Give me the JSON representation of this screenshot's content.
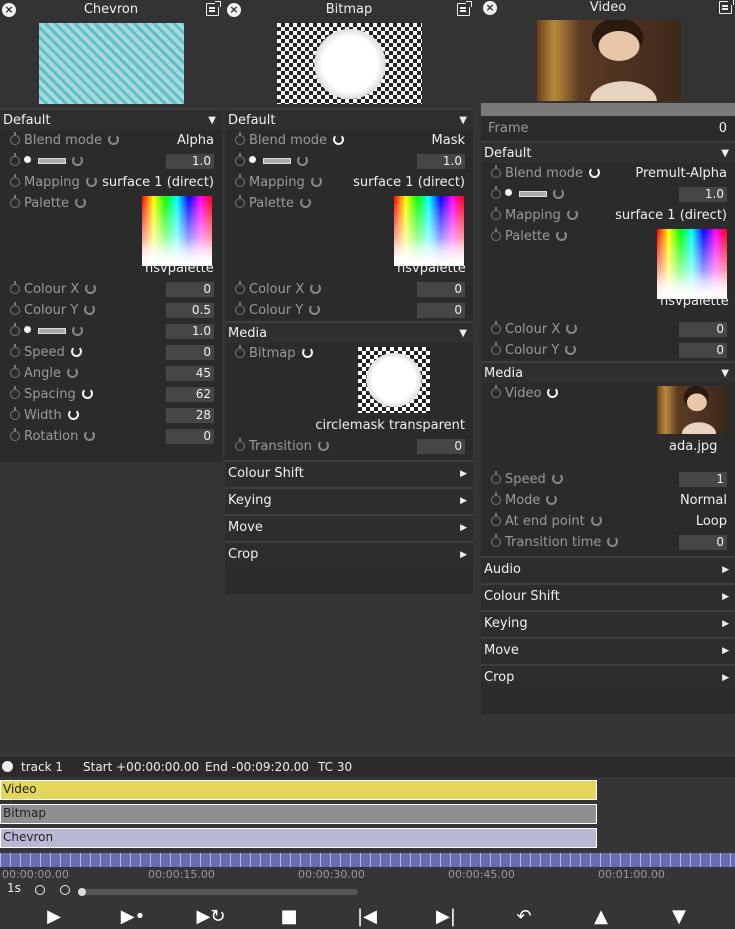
{
  "chevron": {
    "title": "Chevron",
    "section": "Default",
    "blend_label": "Blend mode",
    "blend_value": "Alpha",
    "opacity_value": "1.0",
    "mapping_label": "Mapping",
    "mapping_value": "surface 1 (direct)",
    "palette_label": "Palette",
    "palette_name": "hsvpalette",
    "params": [
      {
        "label": "Colour X",
        "value": "0"
      },
      {
        "label": "Colour Y",
        "value": "0.5"
      },
      {
        "label": "",
        "value": "1.0"
      },
      {
        "label": "Speed",
        "value": "0"
      },
      {
        "label": "Angle",
        "value": "45"
      },
      {
        "label": "Spacing",
        "value": "62"
      },
      {
        "label": "Width",
        "value": "28"
      },
      {
        "label": "Rotation",
        "value": "0"
      }
    ]
  },
  "bitmap": {
    "title": "Bitmap",
    "section": "Default",
    "blend_label": "Blend mode",
    "blend_value": "Mask",
    "opacity_value": "1.0",
    "mapping_label": "Mapping",
    "mapping_value": "surface 1 (direct)",
    "palette_label": "Palette",
    "palette_name": "hsvpalette",
    "colour_x_label": "Colour X",
    "colour_x": "0",
    "colour_y_label": "Colour Y",
    "colour_y": "0",
    "media_section": "Media",
    "bitmap_label": "Bitmap",
    "bitmap_name": "circlemask transparent",
    "transition_label": "Transition",
    "transition_value": "0",
    "collapsed": [
      "Colour Shift",
      "Keying",
      "Move",
      "Crop"
    ]
  },
  "video": {
    "title": "Video",
    "frame_label": "Frame",
    "frame_value": "0",
    "section": "Default",
    "blend_label": "Blend mode",
    "blend_value": "Premult-Alpha",
    "opacity_value": "1.0",
    "mapping_label": "Mapping",
    "mapping_value": "surface 1 (direct)",
    "palette_label": "Palette",
    "palette_name": "hsvpalette",
    "colour_x_label": "Colour X",
    "colour_x": "0",
    "colour_y_label": "Colour Y",
    "colour_y": "0",
    "media_section": "Media",
    "video_label": "Video",
    "video_name": "ada.jpg",
    "speed_label": "Speed",
    "speed_value": "1",
    "mode_label": "Mode",
    "mode_value": "Normal",
    "endpoint_label": "At end point",
    "endpoint_value": "Loop",
    "transition_label": "Transition time",
    "transition_value": "0",
    "collapsed": [
      "Audio",
      "Colour Shift",
      "Keying",
      "Move",
      "Crop"
    ]
  },
  "timeline": {
    "track": "track 1",
    "start": "Start +00:00:00.00",
    "end": "End -00:09:20.00",
    "tc": "TC 30",
    "tracks": [
      "Video",
      "Bitmap",
      "Chevron"
    ],
    "track_colors": [
      "#e4d65a",
      "#8f8f8f",
      "#b9b9d6"
    ],
    "ruler_labels": [
      "00:00:00.00",
      "00:00:15.00",
      "00:00:30.00",
      "00:00:45.00",
      "00:01:00.00"
    ],
    "scale": "1s"
  },
  "icons": [
    "close-icon",
    "menu-icon",
    "clock-icon",
    "reset-icon",
    "bulb-icon",
    "play-icon",
    "play-step-icon",
    "loop-icon",
    "stop-icon",
    "skip-start-icon",
    "skip-end-icon",
    "undo-icon",
    "up-icon",
    "down-icon",
    "zoom-out-icon",
    "zoom-in-icon",
    "help-icon"
  ]
}
